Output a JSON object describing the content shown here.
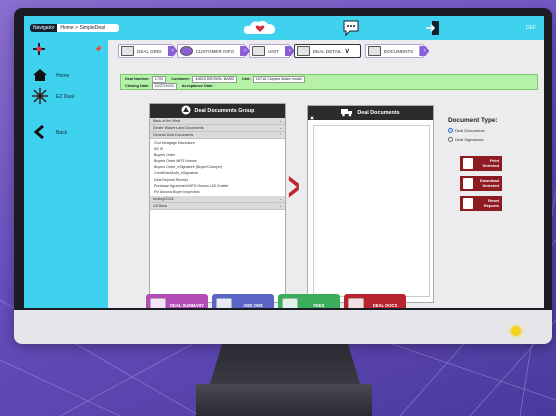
{
  "topbar": {
    "nav_label": "Navigator",
    "breadcrumb": "Home > SimpleDeal",
    "user_label": "DEF"
  },
  "sidebar": {
    "items": [
      {
        "label": "Home",
        "icon": "home-icon"
      },
      {
        "label": "EZ Deal",
        "icon": "ez-deal-icon"
      },
      {
        "label": "Back",
        "icon": "back-arrow-icon"
      }
    ]
  },
  "tabs": [
    {
      "label": "DEAL GRID"
    },
    {
      "label": "CUSTOMER INFO"
    },
    {
      "label": "UNIT"
    },
    {
      "label": "DEAL DETAIL"
    },
    {
      "label": "DOCUMENTS"
    }
  ],
  "deal_info": {
    "deal_number_label": "Deal Number:",
    "deal_number": "1709",
    "customer_label": "Customer:",
    "customer": "49603 BROWN, BARB",
    "unit_label": "Unit:",
    "unit": "15716 Clayton Make model",
    "closing_date_label": "Closing Date:",
    "closing_date": "10/27/2023",
    "acceptance_date_label": "Acceptance Date:"
  },
  "documents_group": {
    "title": "Deal Documents Group",
    "groups_top": [
      "Bank of the West",
      "Dealer Waivers and Documents",
      "General Deal Documents"
    ],
    "documents": [
      "21st Mortgage Disclosure",
      "AS IS",
      "Buyers Order",
      "Buyers Order MFG Homes",
      "Buyers Order_eSignature (Buyer/Cobuyer)",
      "CreditCardAuth_eSignature",
      "Deal Deposit Receipt",
      "Purchase Agreement MFG Homes 100 Chattel",
      "RV Arizona Buyer Inspection"
    ],
    "groups_bottom": [
      "testing22426",
      "US Bank"
    ]
  },
  "deal_documents": {
    "title": "Deal Documents"
  },
  "document_type": {
    "title": "Document Type:",
    "options": [
      {
        "label": "Deal Documents",
        "checked": true
      },
      {
        "label": "Deal Signatures",
        "checked": false
      }
    ]
  },
  "actions": [
    {
      "label": "Print Selected",
      "icon": "print-icon"
    },
    {
      "label": "Download Selected",
      "icon": "download-icon"
    },
    {
      "label": "Reset Reports",
      "icon": "reset-icon"
    }
  ],
  "bottom_buttons": [
    {
      "label": "DEAL SUMMARY",
      "color": "#b24db8"
    },
    {
      "label": "ADD ONS",
      "color": "#5a64c4"
    },
    {
      "label": "FEES",
      "color": "#3aae5a"
    },
    {
      "label": "DEAL DOCS",
      "color": "#b8242e"
    }
  ],
  "colors": {
    "topbar": "#3ed2ee",
    "accent_red": "#8e1a22",
    "deal_info_bg": "#b5f2a8"
  }
}
